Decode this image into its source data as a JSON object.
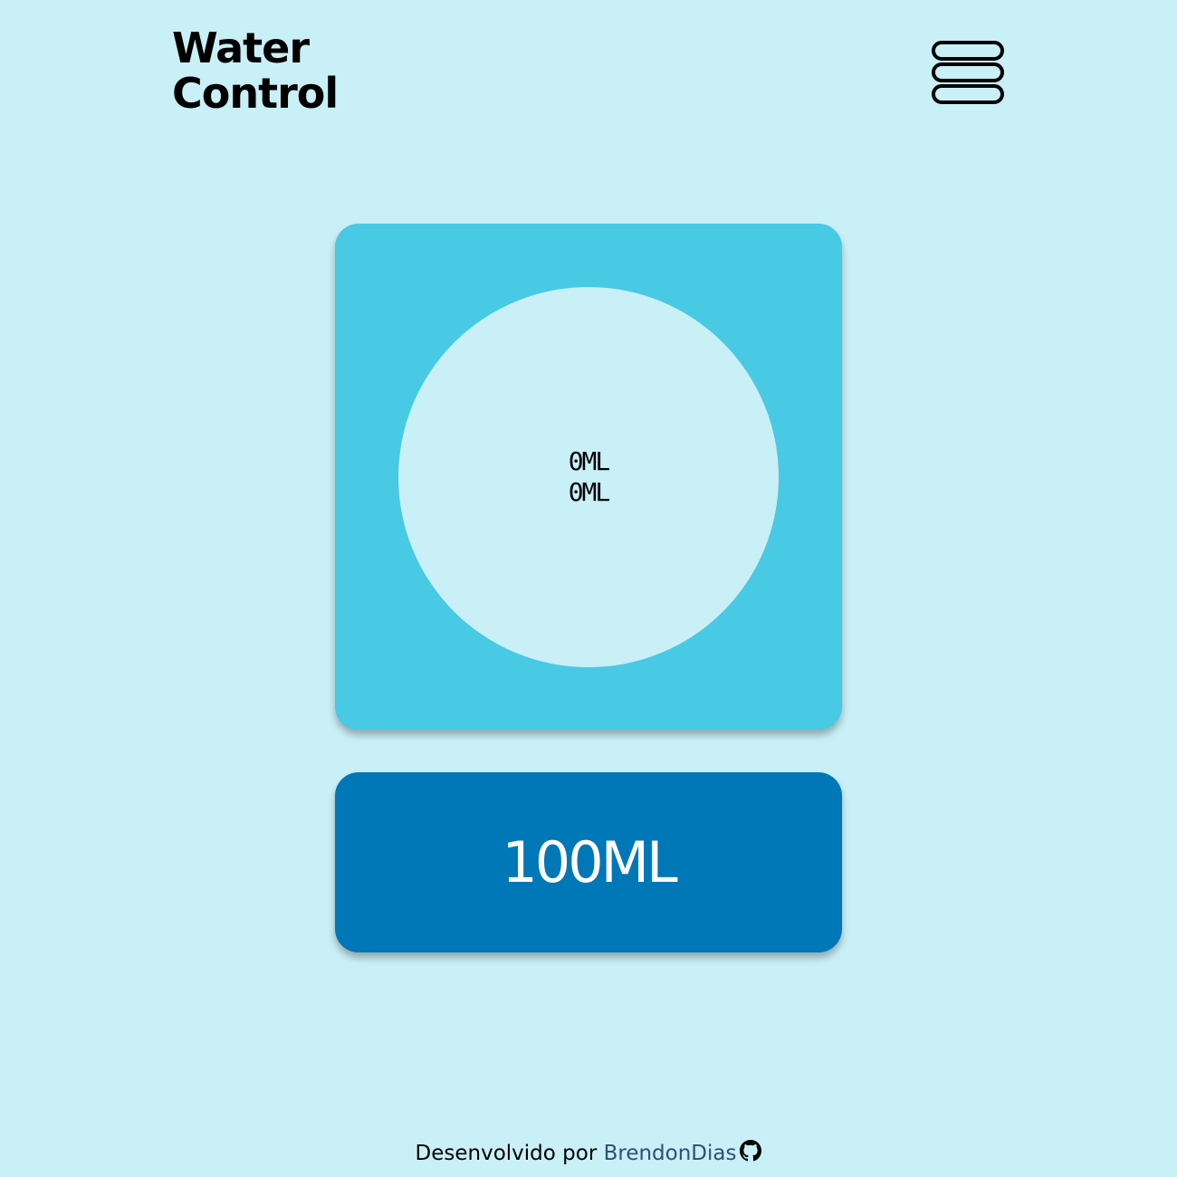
{
  "header": {
    "logo_line1": "Water",
    "logo_line2": "Control",
    "menu_icon": "stacked-bars-menu-icon"
  },
  "tracker": {
    "consumed": "0ML",
    "goal": "0ML"
  },
  "add_button": {
    "label": "100ML"
  },
  "footer": {
    "prefix": "Desenvolvido por ",
    "author": "BrendonDias",
    "icon": "github-icon"
  },
  "colors": {
    "background": "#c9eff7",
    "card": "#48c9e4",
    "button": "#0077b6",
    "link": "#2e4f74"
  }
}
